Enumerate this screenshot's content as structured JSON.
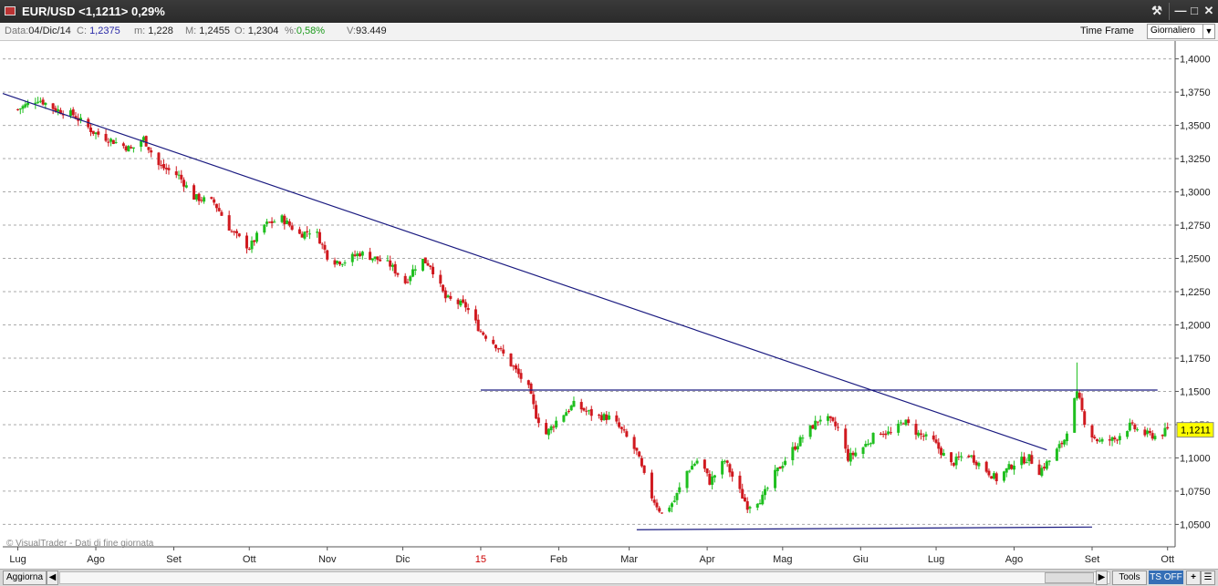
{
  "window": {
    "title": "EUR/USD <1,1211> 0,29%"
  },
  "infobar": {
    "data_label": "Data:",
    "data_value": "04/Dic/14",
    "c_label": "C:",
    "c_value": "1,2375",
    "m_label": "m:",
    "m_value": "1,228",
    "M_label": "M:",
    "M_value": "1,2455",
    "o_label": "O:",
    "o_value": "1,2304",
    "pct_label": "%:",
    "pct_value": "0,58%",
    "v_label": "V:",
    "v_value": "93.449",
    "time_frame_label": "Time Frame",
    "time_frame_value": "Giornaliero"
  },
  "chart_data": {
    "type": "candlestick",
    "symbol": "EUR/USD",
    "watermark": "© VisualTrader - Dati di fine giornata",
    "current_price_label": "1,1211",
    "ylim": [
      1.04,
      1.41
    ],
    "y_ticks": [
      "1,4000",
      "1,3750",
      "1,3500",
      "1,3250",
      "1,3000",
      "1,2750",
      "1,2500",
      "1,2250",
      "1,2000",
      "1,1750",
      "1,1500",
      "1,1250",
      "1,1000",
      "1,0750",
      "1,0500"
    ],
    "y_tick_values": [
      1.4,
      1.375,
      1.35,
      1.325,
      1.3,
      1.275,
      1.25,
      1.225,
      1.2,
      1.175,
      1.15,
      1.125,
      1.1,
      1.075,
      1.05
    ],
    "x_ticks": [
      {
        "label": "Lug",
        "day": 0
      },
      {
        "label": "Ago",
        "day": 31
      },
      {
        "label": "Set",
        "day": 62
      },
      {
        "label": "Ott",
        "day": 92
      },
      {
        "label": "Nov",
        "day": 123
      },
      {
        "label": "Dic",
        "day": 153
      },
      {
        "label": "15",
        "day": 184
      },
      {
        "label": "Feb",
        "day": 215
      },
      {
        "label": "Mar",
        "day": 243
      },
      {
        "label": "Apr",
        "day": 274
      },
      {
        "label": "Mag",
        "day": 304
      },
      {
        "label": "Giu",
        "day": 335
      },
      {
        "label": "Lug",
        "day": 365
      },
      {
        "label": "Ago",
        "day": 396
      },
      {
        "label": "Set",
        "day": 427
      },
      {
        "label": "Ott",
        "day": 457
      }
    ],
    "x_domain_days": [
      -6,
      460
    ],
    "anchors": [
      [
        0,
        1.362
      ],
      [
        8,
        1.37
      ],
      [
        15,
        1.362
      ],
      [
        22,
        1.358
      ],
      [
        30,
        1.345
      ],
      [
        38,
        1.338
      ],
      [
        45,
        1.332
      ],
      [
        50,
        1.34
      ],
      [
        56,
        1.32
      ],
      [
        64,
        1.312
      ],
      [
        70,
        1.296
      ],
      [
        78,
        1.292
      ],
      [
        85,
        1.27
      ],
      [
        92,
        1.258
      ],
      [
        98,
        1.275
      ],
      [
        105,
        1.28
      ],
      [
        112,
        1.268
      ],
      [
        118,
        1.272
      ],
      [
        124,
        1.248
      ],
      [
        130,
        1.248
      ],
      [
        136,
        1.254
      ],
      [
        142,
        1.25
      ],
      [
        148,
        1.245
      ],
      [
        154,
        1.232
      ],
      [
        160,
        1.25
      ],
      [
        164,
        1.245
      ],
      [
        170,
        1.22
      ],
      [
        178,
        1.214
      ],
      [
        184,
        1.195
      ],
      [
        190,
        1.185
      ],
      [
        197,
        1.168
      ],
      [
        203,
        1.152
      ],
      [
        206,
        1.132
      ],
      [
        210,
        1.118
      ],
      [
        215,
        1.13
      ],
      [
        221,
        1.14
      ],
      [
        229,
        1.132
      ],
      [
        236,
        1.13
      ],
      [
        241,
        1.118
      ],
      [
        246,
        1.104
      ],
      [
        251,
        1.074
      ],
      [
        256,
        1.058
      ],
      [
        261,
        1.068
      ],
      [
        266,
        1.09
      ],
      [
        271,
        1.1
      ],
      [
        275,
        1.082
      ],
      [
        281,
        1.098
      ],
      [
        286,
        1.078
      ],
      [
        290,
        1.064
      ],
      [
        296,
        1.07
      ],
      [
        301,
        1.088
      ],
      [
        307,
        1.104
      ],
      [
        313,
        1.118
      ],
      [
        320,
        1.132
      ],
      [
        326,
        1.122
      ],
      [
        330,
        1.1
      ],
      [
        336,
        1.108
      ],
      [
        342,
        1.12
      ],
      [
        348,
        1.118
      ],
      [
        352,
        1.128
      ],
      [
        358,
        1.118
      ],
      [
        364,
        1.112
      ],
      [
        371,
        1.095
      ],
      [
        377,
        1.104
      ],
      [
        383,
        1.094
      ],
      [
        389,
        1.084
      ],
      [
        396,
        1.096
      ],
      [
        402,
        1.1
      ],
      [
        406,
        1.09
      ],
      [
        411,
        1.1
      ],
      [
        416,
        1.114
      ],
      [
        421,
        1.15
      ],
      [
        425,
        1.12
      ],
      [
        430,
        1.112
      ],
      [
        436,
        1.114
      ],
      [
        442,
        1.124
      ],
      [
        448,
        1.118
      ],
      [
        453,
        1.116
      ],
      [
        457,
        1.121
      ]
    ],
    "trendlines": [
      {
        "name": "resistance-down",
        "p1": [
          -6,
          1.374
        ],
        "p2": [
          409,
          1.106
        ]
      },
      {
        "name": "horizontal-1150",
        "p1": [
          184,
          1.151
        ],
        "p2": [
          453,
          1.151
        ]
      },
      {
        "name": "support-low",
        "p1": [
          246,
          1.046
        ],
        "p2": [
          427,
          1.048
        ]
      }
    ],
    "colors": {
      "up": "#1fbf1f",
      "down": "#d0191f",
      "grid": "#aaaaaa",
      "trendline": "#1a1a80",
      "label_bg": "#ffff00"
    }
  },
  "bottombar": {
    "refresh_label": "Aggiorna",
    "tools_label": "Tools",
    "ts_label": "TS OFF",
    "plus_label": "+"
  },
  "icons": {
    "app": "chart-app-icon",
    "tool": "pin-icon",
    "minimize": "minimize-icon",
    "maximize": "maximize-icon",
    "close": "close-icon"
  }
}
